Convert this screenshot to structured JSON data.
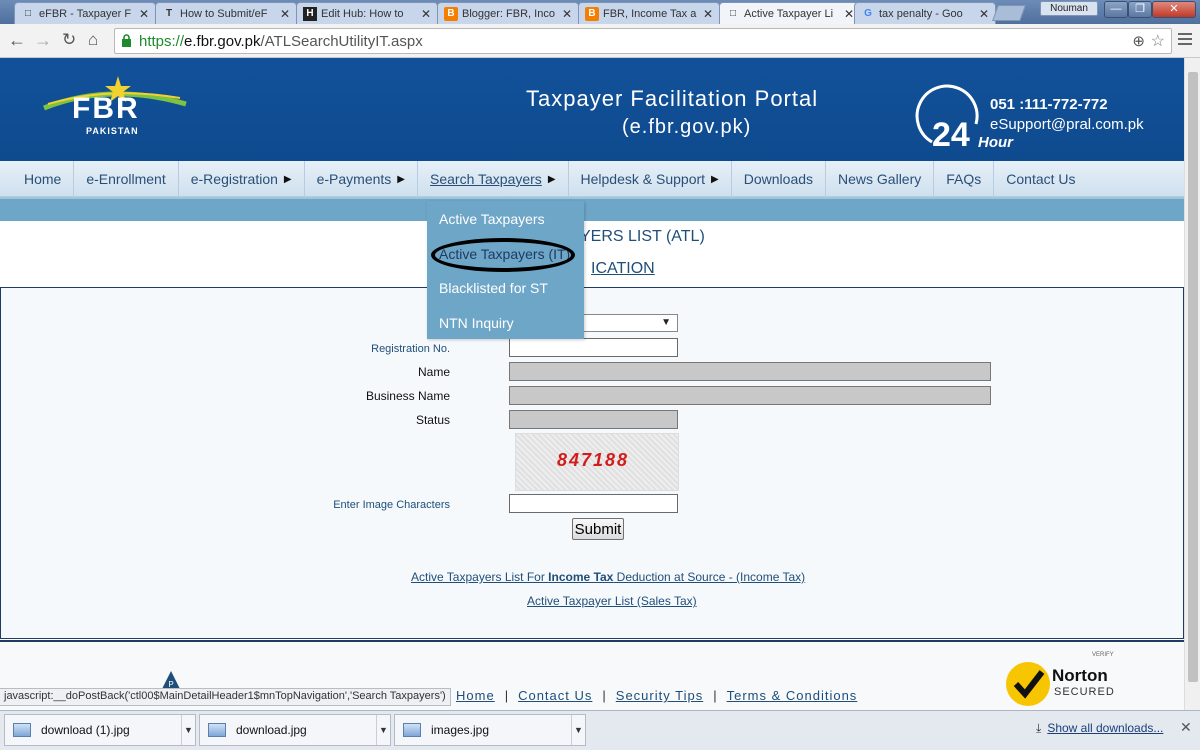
{
  "browser": {
    "tabs": [
      {
        "label": "eFBR - Taxpayer F",
        "icon": "doc"
      },
      {
        "label": "How to Submit/eF",
        "icon": "T"
      },
      {
        "label": "Edit Hub: How to",
        "icon": "H"
      },
      {
        "label": "Blogger: FBR, Inco",
        "icon": "B"
      },
      {
        "label": "FBR, Income Tax a",
        "icon": "B"
      },
      {
        "label": "Active Taxpayer Li",
        "icon": "doc"
      },
      {
        "label": "tax penalty - Goo",
        "icon": "G"
      }
    ],
    "active_tab_index": 5,
    "profile_name": "Nouman",
    "url_scheme": "https://",
    "url_host": "e.fbr.gov.pk",
    "url_path": "/ATLSearchUtilityIT.aspx"
  },
  "header": {
    "logo_text": "FBR",
    "logo_sub": "PAKISTAN",
    "portal_title": "Taxpayer Facilitation Portal",
    "portal_subtitle": "(e.fbr.gov.pk)",
    "hours_number": "24",
    "hours_label": "Hour",
    "phone": "051 :111-772-772",
    "email": "eSupport@pral.com.pk"
  },
  "nav": {
    "items": [
      {
        "label": "Home",
        "has_caret": false
      },
      {
        "label": "e-Enrollment",
        "has_caret": false
      },
      {
        "label": "e-Registration",
        "has_caret": true
      },
      {
        "label": "e-Payments",
        "has_caret": true
      },
      {
        "label": "Search Taxpayers",
        "has_caret": true
      },
      {
        "label": "Helpdesk & Support",
        "has_caret": true
      },
      {
        "label": "Downloads",
        "has_caret": false
      },
      {
        "label": "News Gallery",
        "has_caret": false
      },
      {
        "label": "FAQs",
        "has_caret": false
      },
      {
        "label": "Contact Us",
        "has_caret": false
      }
    ],
    "dropdown": [
      "Active Taxpayers",
      "Active Taxpayers (IT)",
      "Blacklisted for ST",
      "NTN Inquiry"
    ]
  },
  "page": {
    "title_partial": "YERS LIST (ATL)",
    "subtitle_partial": "ICATION"
  },
  "form": {
    "registration_label": "Registration No.",
    "name_label": "Name",
    "business_label": "Business Name",
    "status_label": "Status",
    "captcha_code": "847188",
    "captcha_label": "Enter Image Characters",
    "submit_label": "Submit",
    "select_caret": "▼",
    "link_income_pre": "Active Taxpayers List For ",
    "link_income_bold": "Income Tax",
    "link_income_post": " Deduction at Source - (Income Tax)",
    "link_sales": "Active Taxpayer List (Sales Tax)"
  },
  "footer": {
    "links": [
      "Home",
      "Contact Us",
      "Security Tips",
      "Terms & Conditions"
    ],
    "separator": "|",
    "norton_verify": "VERIFY",
    "norton_name": "Norton",
    "norton_secured": "SECURED"
  },
  "status_bar": {
    "text": "javascript:__doPostBack('ctl00$MainDetailHeader1$mnTopNavigation','Search Taxpayers')"
  },
  "downloads": {
    "items": [
      "download (1).jpg",
      "download.jpg",
      "images.jpg"
    ],
    "show_all": "Show all downloads..."
  }
}
